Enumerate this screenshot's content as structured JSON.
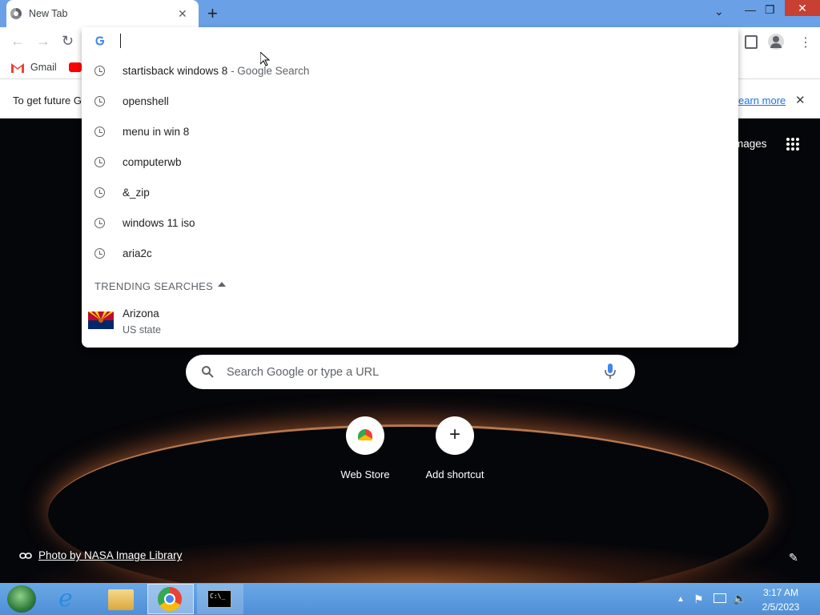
{
  "browser": {
    "tab_title": "New Tab",
    "tab_close": "✕",
    "new_tab": "+",
    "window_controls": {
      "tab_search": "⌄",
      "minimize": "—",
      "restore": "❐",
      "close": "✕"
    },
    "nav": {
      "back": "←",
      "forward": "→",
      "reload": "↻"
    },
    "omnibox_value": "",
    "bookmarks": [
      {
        "label": "Gmail"
      }
    ],
    "infobar": {
      "text": "To get future G",
      "link": "earn more",
      "close": "✕"
    }
  },
  "omnibox_suggestions": [
    {
      "text": "startisback windows 8",
      "sub": " - Google Search"
    },
    {
      "text": "openshell",
      "sub": ""
    },
    {
      "text": "menu in win 8",
      "sub": ""
    },
    {
      "text": "computerwb",
      "sub": ""
    },
    {
      "text": "&_zip",
      "sub": ""
    },
    {
      "text": "windows 11 iso",
      "sub": ""
    },
    {
      "text": "aria2c",
      "sub": ""
    }
  ],
  "trending": {
    "header": "TRENDING SEARCHES",
    "items": [
      {
        "title": "Arizona",
        "subtitle": "US state"
      }
    ]
  },
  "newtab": {
    "images_link": "mages",
    "search_placeholder": "Search Google or type a URL",
    "shortcuts": [
      {
        "label": "Web Store"
      },
      {
        "label": "Add shortcut"
      }
    ],
    "photo_credit": "Photo by NASA Image Library"
  },
  "taskbar": {
    "time": "3:17 AM",
    "date": "2/5/2023"
  },
  "colors": {
    "tabstrip": "#6aa0e6",
    "close_red": "#c84031",
    "taskbar": "#4f8fd6"
  }
}
